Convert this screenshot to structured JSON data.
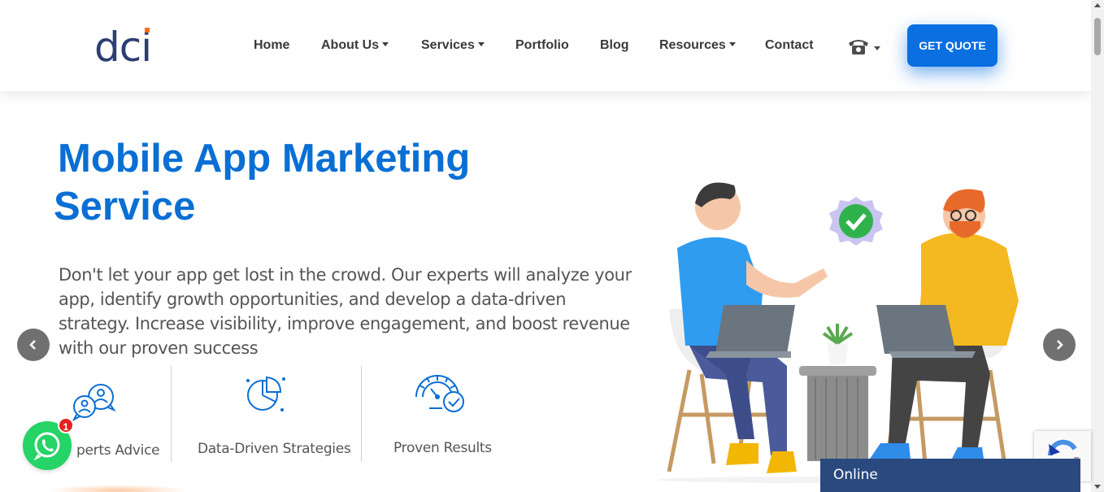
{
  "header": {
    "logo_text": "dci",
    "nav": [
      {
        "label": "Home",
        "dropdown": false
      },
      {
        "label": "About Us",
        "dropdown": true
      },
      {
        "label": "Services",
        "dropdown": true
      },
      {
        "label": "Portfolio",
        "dropdown": false
      },
      {
        "label": "Blog",
        "dropdown": false
      },
      {
        "label": "Resources",
        "dropdown": true
      },
      {
        "label": "Contact",
        "dropdown": false
      }
    ],
    "phone_icon": "phone-icon",
    "cta_label": "GET QUOTE"
  },
  "hero": {
    "title_line1": "Mobile App Marketing",
    "title_line2": "Service",
    "description": "Don't let your app get lost in the crowd. Our experts will analyze your app, identify growth opportunities, and develop a data-driven strategy. Increase visibility, improve engagement, and boost revenue with our proven success",
    "features": [
      {
        "label": "perts Advice",
        "icon": "experts-icon"
      },
      {
        "label": "Data-Driven Strategies",
        "icon": "pie-chart-icon"
      },
      {
        "label": "Proven Results",
        "icon": "gauge-check-icon"
      }
    ]
  },
  "widgets": {
    "whatsapp_badge": "1",
    "online_label": "Online"
  },
  "colors": {
    "brand_blue": "#0a6fd4",
    "cta_blue": "#0a6fe0",
    "logo_navy": "#2c3e73",
    "whatsapp_green": "#25d366",
    "online_bar": "#2a4a7f"
  }
}
